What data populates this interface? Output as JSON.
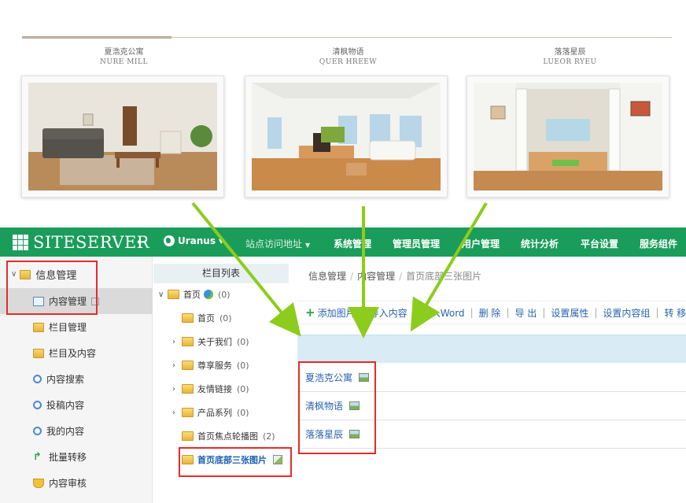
{
  "showcase": {
    "cards": [
      {
        "title": "夏浩克公寓",
        "subtitle": "NURE MILL"
      },
      {
        "title": "清枫物语",
        "subtitle": "QUER HREEW"
      },
      {
        "title": "落落星辰",
        "subtitle": "LUEOR RYEU"
      }
    ]
  },
  "header": {
    "logo_text": "SITESERVER",
    "back_icon": "←",
    "site_name": "Uranus",
    "menu": [
      "站点访问地址",
      "系统管理",
      "管理员管理",
      "用户管理",
      "统计分析",
      "平台设置",
      "服务组件"
    ]
  },
  "sidebar": {
    "section_label": "信息管理",
    "items": [
      {
        "label": "内容管理",
        "icon": "content-icon"
      },
      {
        "label": "栏目管理",
        "icon": "folder-icon"
      },
      {
        "label": "栏目及内容",
        "icon": "folder-icon"
      },
      {
        "label": "内容搜索",
        "icon": "search-icon"
      },
      {
        "label": "投稿内容",
        "icon": "search-icon"
      },
      {
        "label": "我的内容",
        "icon": "search-icon"
      },
      {
        "label": "批量转移",
        "icon": "move-icon"
      },
      {
        "label": "内容审核",
        "icon": "shield-icon"
      }
    ]
  },
  "tree": {
    "header": "栏目列表",
    "items": [
      {
        "label": "首页",
        "count": "(0)"
      },
      {
        "label": "首页",
        "count": "(0)"
      },
      {
        "label": "关于我们",
        "count": "(0)"
      },
      {
        "label": "尊享服务",
        "count": "(0)"
      },
      {
        "label": "友情链接",
        "count": "(0)"
      },
      {
        "label": "产品系列",
        "count": "(0)"
      },
      {
        "label": "首页焦点轮播图",
        "count": "(2)"
      },
      {
        "label": "首页底部三张图片",
        "count": ""
      }
    ]
  },
  "content": {
    "breadcrumb": [
      "信息管理",
      "内容管理",
      "首页底部三张图片"
    ],
    "toolbar": [
      "添加图片",
      "导入内容",
      "导入Word",
      "删 除",
      "导 出",
      "设置属性",
      "设置内容组",
      "转 移"
    ],
    "rows": [
      "夏浩克公寓",
      "清枫物语",
      "落落星辰"
    ]
  },
  "colors": {
    "brand": "#1a9d5a",
    "highlight": "#e52b2b",
    "arrow": "#8ccc1c",
    "link": "#2a63b0"
  }
}
